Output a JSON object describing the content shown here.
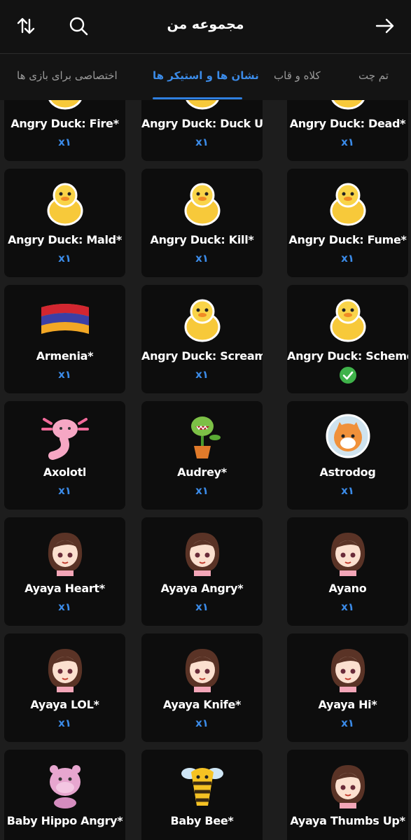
{
  "header": {
    "title": "مجموعه من",
    "sort_icon": "sort-arrows-icon",
    "search_icon": "search-icon",
    "back_icon": "arrow-right-icon"
  },
  "tabs": [
    {
      "label": "اختصاصی برای بازی ها",
      "active": false
    },
    {
      "label": "نشان ها و استیکر ها",
      "active": true
    },
    {
      "label": "کلاه و قاب",
      "active": false
    },
    {
      "label": "تم چت",
      "active": false
    }
  ],
  "colors": {
    "accent": "#3b8be8",
    "card_bg": "#0d0d0d",
    "page_bg": "#1d1d1d",
    "check_green": "#3fb24a"
  },
  "items": [
    {
      "name": "Angry Duck: Fire*",
      "qty": "x۱",
      "sticker": "duck"
    },
    {
      "name": "Angry Duck: Duck U*",
      "qty": "x۱",
      "sticker": "duck"
    },
    {
      "name": "Angry Duck: Dead*",
      "qty": "x۱",
      "sticker": "duck"
    },
    {
      "name": "Angry Duck: Mald*",
      "qty": "x۱",
      "sticker": "duck"
    },
    {
      "name": "Angry Duck: Kill*",
      "qty": "x۱",
      "sticker": "duck"
    },
    {
      "name": "Angry Duck: Fume*",
      "qty": "x۱",
      "sticker": "duck"
    },
    {
      "name": "Armenia*",
      "qty": "x۱",
      "sticker": "flag"
    },
    {
      "name": "Angry Duck: Scream*",
      "qty": "x۱",
      "sticker": "duck"
    },
    {
      "name": "Angry Duck: Scheme*",
      "qty": "",
      "sticker": "duck",
      "equipped": true
    },
    {
      "name": "Axolotl",
      "qty": "x۱",
      "sticker": "axolotl"
    },
    {
      "name": "Audrey*",
      "qty": "x۱",
      "sticker": "plant"
    },
    {
      "name": "Astrodog",
      "qty": "x۱",
      "sticker": "dog"
    },
    {
      "name": "Ayaya Heart*",
      "qty": "x۱",
      "sticker": "girl"
    },
    {
      "name": "Ayaya Angry*",
      "qty": "x۱",
      "sticker": "girl"
    },
    {
      "name": "Ayano",
      "qty": "x۱",
      "sticker": "girl"
    },
    {
      "name": "Ayaya LOL*",
      "qty": "x۱",
      "sticker": "girl"
    },
    {
      "name": "Ayaya Knife*",
      "qty": "x۱",
      "sticker": "girl"
    },
    {
      "name": "Ayaya Hi*",
      "qty": "x۱",
      "sticker": "girl"
    },
    {
      "name": "Baby Hippo Angry*",
      "qty": "",
      "sticker": "hippo"
    },
    {
      "name": "Baby Bee*",
      "qty": "",
      "sticker": "bee"
    },
    {
      "name": "Ayaya Thumbs Up*",
      "qty": "",
      "sticker": "girl"
    }
  ]
}
